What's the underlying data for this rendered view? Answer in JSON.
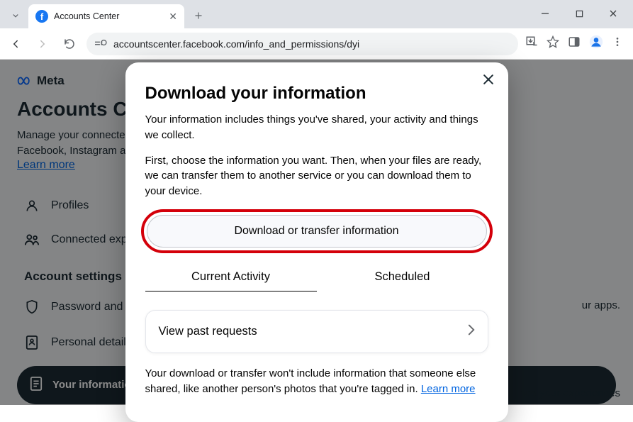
{
  "browser": {
    "tab_title": "Accounts Center",
    "url_display": "accountscenter.facebook.com/info_and_permissions/dyi"
  },
  "page": {
    "brand": "Meta",
    "title": "Accounts Center",
    "subtitle": "Manage your connected experiences and account settings across Meta technologies like Facebook, Instagram and more.",
    "learn_more": "Learn more",
    "sidebar": {
      "profiles": "Profiles",
      "connected": "Connected experiences",
      "section": "Account settings",
      "password": "Password and security",
      "personal": "Personal details",
      "active_item": "Your information and permissions"
    },
    "right_hint_1": "ur apps.",
    "right_hint_2": "nce your experiences"
  },
  "modal": {
    "title": "Download your information",
    "para1": "Your information includes things you've shared, your activity and things we collect.",
    "para2": "First, choose the information you want. Then, when your files are ready, we can transfer them to another service or you can download them to your device.",
    "cta": "Download or transfer information",
    "tabs": {
      "current": "Current Activity",
      "scheduled": "Scheduled"
    },
    "past_requests": "View past requests",
    "footnote": "Your download or transfer won't include information that someone else shared, like another person's photos that you're tagged in. ",
    "footnote_link": "Learn more"
  }
}
